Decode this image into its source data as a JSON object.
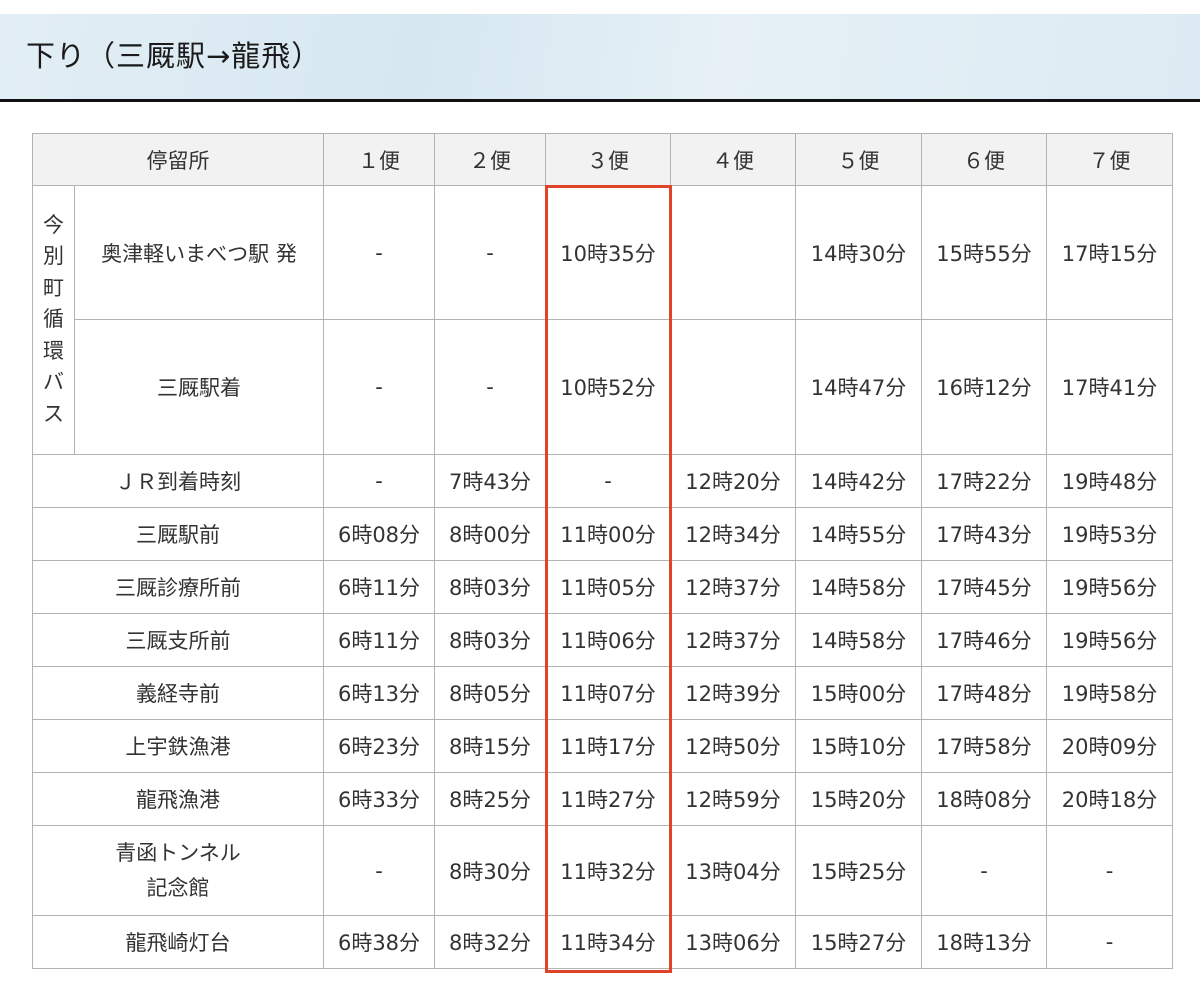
{
  "heading": "下り（三厩駅→龍飛）",
  "table": {
    "header": {
      "stop": "停留所",
      "trips": [
        "１便",
        "２便",
        "３便",
        "４便",
        "５便",
        "６便",
        "７便"
      ]
    },
    "loop_bus": {
      "label_chars": [
        "今",
        "別",
        "町",
        "循",
        "環",
        "バ",
        "ス"
      ],
      "rows": [
        {
          "stop": "奥津軽いまべつ駅 発",
          "times": [
            "-",
            "-",
            "10時35分",
            "",
            "14時30分",
            "15時55分",
            "17時15分"
          ]
        },
        {
          "stop": "三厩駅着",
          "times": [
            "-",
            "-",
            "10時52分",
            "",
            "14時47分",
            "16時12分",
            "17時41分"
          ]
        }
      ]
    },
    "rows": [
      {
        "stop": "ＪＲ到着時刻",
        "times": [
          "-",
          "7時43分",
          "-",
          "12時20分",
          "14時42分",
          "17時22分",
          "19時48分"
        ]
      },
      {
        "stop": "三厩駅前",
        "times": [
          "6時08分",
          "8時00分",
          "11時00分",
          "12時34分",
          "14時55分",
          "17時43分",
          "19時53分"
        ]
      },
      {
        "stop": "三厩診療所前",
        "times": [
          "6時11分",
          "8時03分",
          "11時05分",
          "12時37分",
          "14時58分",
          "17時45分",
          "19時56分"
        ]
      },
      {
        "stop": "三厩支所前",
        "times": [
          "6時11分",
          "8時03分",
          "11時06分",
          "12時37分",
          "14時58分",
          "17時46分",
          "19時56分"
        ]
      },
      {
        "stop": "義経寺前",
        "times": [
          "6時13分",
          "8時05分",
          "11時07分",
          "12時39分",
          "15時00分",
          "17時48分",
          "19時58分"
        ]
      },
      {
        "stop": "上宇鉄漁港",
        "times": [
          "6時23分",
          "8時15分",
          "11時17分",
          "12時50分",
          "15時10分",
          "17時58分",
          "20時09分"
        ]
      },
      {
        "stop": "龍飛漁港",
        "times": [
          "6時33分",
          "8時25分",
          "11時27分",
          "12時59分",
          "15時20分",
          "18時08分",
          "20時18分"
        ]
      },
      {
        "stop_lines": [
          "青函トンネル",
          "記念館"
        ],
        "times": [
          "-",
          "8時30分",
          "11時32分",
          "13時04分",
          "15時25分",
          "-",
          "-"
        ]
      },
      {
        "stop": "龍飛崎灯台",
        "times": [
          "6時38分",
          "8時32分",
          "11時34分",
          "13時06分",
          "15時27分",
          "18時13分",
          "-"
        ]
      }
    ]
  },
  "highlight": {
    "trip_label": "３便",
    "color": "#e0432a"
  }
}
